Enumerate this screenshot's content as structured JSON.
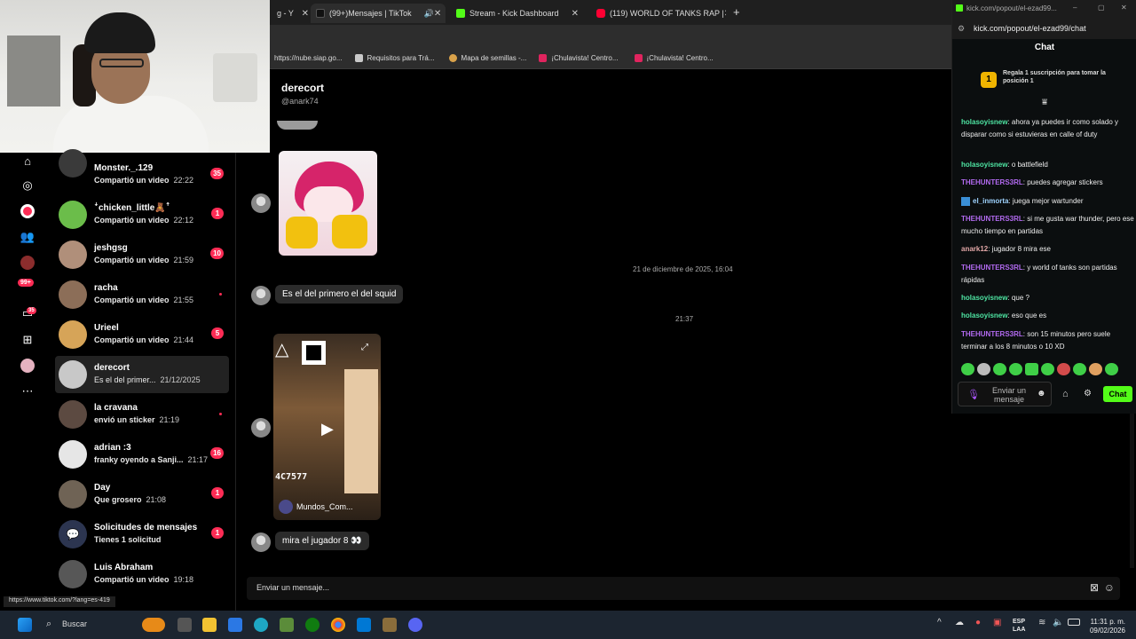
{
  "browser": {
    "tabs": [
      {
        "label": "g - Y",
        "active": false
      },
      {
        "label": "(99+)Mensajes | TikTok",
        "active": true
      },
      {
        "label": "Stream - Kick Dashboard",
        "active": false
      },
      {
        "label": "(119) WORLD OF TANKS RAP |",
        "active": false
      }
    ],
    "new_tab_icon": "plus-icon",
    "bookmarks": [
      {
        "label": "https://nube.siap.go..."
      },
      {
        "label": "Requisitos para Trá..."
      },
      {
        "label": "Mapa de semillas -..."
      },
      {
        "label": "¡Chulavista! Centro..."
      },
      {
        "label": "¡Chulavista! Centro..."
      }
    ],
    "status_url": "https://www.tiktok.com/?lang=es-419"
  },
  "tiktok": {
    "rail_icons": [
      "home-icon",
      "explore-icon",
      "live-icon",
      "following-icon",
      "profile-icon",
      "activity-icon",
      "messages-icon",
      "upload-icon",
      "avatar-icon",
      "more-icon"
    ],
    "rail_activity_badge": "99+",
    "rail_messages_badge": "35",
    "conversations": [
      {
        "name": "Monster._.129",
        "preview": "Compartió un video",
        "time": "22:22",
        "badge": "35",
        "color": "#3a3a3a"
      },
      {
        "name": "ꜜchicken_little🧸ꜛ",
        "preview": "Compartió un video",
        "time": "22:12",
        "badge": "1",
        "color": "#6bbd4a"
      },
      {
        "name": "jeshgsg",
        "preview": "Compartió un video",
        "time": "21:59",
        "badge": "10",
        "color": "#b08f7a"
      },
      {
        "name": "racha",
        "preview": "Compartió un video",
        "time": "21:55",
        "badge": "",
        "color": "#8c6e58"
      },
      {
        "name": "Urieel",
        "preview": "Compartió un video",
        "time": "21:44",
        "badge": "5",
        "color": "#d6a458"
      },
      {
        "name": "derecort",
        "preview": "Es el del primer...",
        "time": "21/12/2025",
        "badge": "",
        "color": "#c8c8c8"
      },
      {
        "name": "la cravana",
        "preview": "envió un sticker",
        "time": "21:19",
        "badge": "",
        "color": "#5c4a41"
      },
      {
        "name": "adrian :3",
        "preview": "franky oyendo a Sanji...",
        "time": "21:17",
        "badge": "16",
        "color": "#e6e6e6"
      },
      {
        "name": "Day",
        "preview": "Que grosero",
        "time": "21:08",
        "badge": "1",
        "color": "#6f6355"
      },
      {
        "name": "Solicitudes de mensajes",
        "preview": "Tienes 1 solicitud",
        "time": "",
        "badge": "1",
        "color": "#2c3550"
      },
      {
        "name": "Luis Abraham",
        "preview": "Compartió un video",
        "time": "19:18",
        "badge": "",
        "color": "#575757"
      }
    ],
    "chat": {
      "name": "derecort",
      "handle": "@anark74",
      "date_stamp": "21 de diciembre de 2025, 16:04",
      "time_stamp": "21:37",
      "messages": [
        "Es el del primero el del squid",
        "mira el jugador 8 👀"
      ],
      "video_caption": "Mundos_Com...",
      "video_overlay_text": "4C7577",
      "input_placeholder": "Enviar un mensaje..."
    }
  },
  "kick": {
    "window_title": "kick.com/popout/el-ezad99...",
    "url": "kick.com/popout/el-ezad99/chat",
    "chat_label": "Chat",
    "promo_text": "Regala 1 suscripción para tomar la posición 1",
    "promo_rank": "1",
    "messages": [
      {
        "user": "holasoyisnew",
        "color": "#4ee4a2",
        "text": "ahora ya puedes ir como solado y disparar como si estuvieras en calle of duty"
      },
      {
        "user": "holasoyisnew",
        "color": "#4ee4a2",
        "text": "o battlefield"
      },
      {
        "user": "THEHUNTERS3RL",
        "color": "#b26af0",
        "text": "puedes agregar stickers"
      },
      {
        "user": "el_inmorta",
        "color": "#9fd3ff",
        "text": "juega mejor wartunder"
      },
      {
        "user": "THEHUNTERS3RL",
        "color": "#b26af0",
        "text": "si me gusta war thunder, pero ese mucho tiempo en partidas"
      },
      {
        "user": "anark12",
        "color": "#e3a8a8",
        "text": "jugador 8 mira ese"
      },
      {
        "user": "THEHUNTERS3RL",
        "color": "#b26af0",
        "text": "y world of tanks son partidas rápidas"
      },
      {
        "user": "holasoyisnew",
        "color": "#4ee4a2",
        "text": "que ?"
      },
      {
        "user": "holasoyisnew",
        "color": "#4ee4a2",
        "text": "eso que es"
      },
      {
        "user": "THEHUNTERS3RL",
        "color": "#b26af0",
        "text": "son 15 minutos pero suele terminar a los 8 minutos o 10 XD"
      }
    ],
    "input_placeholder": "Enviar un mensaje",
    "send_label": "Chat",
    "accent": "#53fc18"
  },
  "taskbar": {
    "search_label": "Buscar",
    "lang": "ESP",
    "lang_sub": "LAA",
    "time": "11:31 p. m.",
    "date": "09/02/2026"
  }
}
